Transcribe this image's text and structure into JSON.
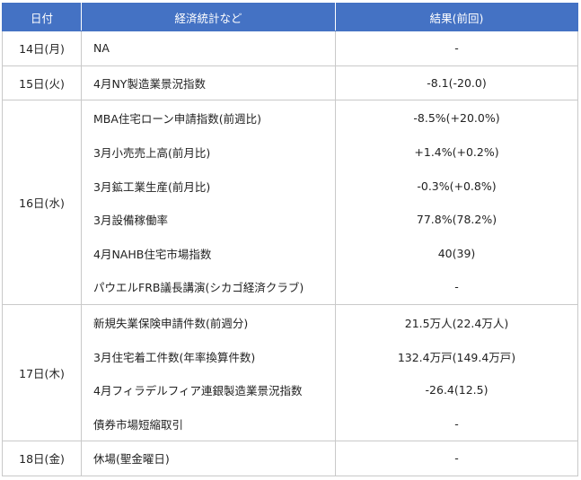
{
  "headers": {
    "date": "日付",
    "event": "経済統計など",
    "result": "結果(前回)"
  },
  "groups": [
    {
      "date": "14日(月)",
      "rows": [
        {
          "event": "NA",
          "result": "-"
        }
      ]
    },
    {
      "date": "15日(火)",
      "rows": [
        {
          "event": "4月NY製造業景況指数",
          "result": "-8.1(-20.0)"
        }
      ]
    },
    {
      "date": "16日(水)",
      "rows": [
        {
          "event": "MBA住宅ローン申請指数(前週比)",
          "result": "-8.5%(+20.0%)"
        },
        {
          "event": "3月小売売上高(前月比)",
          "result": "+1.4%(+0.2%)"
        },
        {
          "event": "3月鉱工業生産(前月比)",
          "result": "-0.3%(+0.8%)"
        },
        {
          "event": "3月設備稼働率",
          "result": "77.8%(78.2%)"
        },
        {
          "event": "4月NAHB住宅市場指数",
          "result": "40(39)"
        },
        {
          "event": "パウエルFRB議長講演(シカゴ経済クラブ)",
          "result": "-"
        }
      ]
    },
    {
      "date": "17日(木)",
      "rows": [
        {
          "event": "新規失業保険申請件数(前週分)",
          "result": "21.5万人(22.4万人)"
        },
        {
          "event": "3月住宅着工件数(年率換算件数)",
          "result": "132.4万戸(149.4万戸)"
        },
        {
          "event": "4月フィラデルフィア連銀製造業景況指数",
          "result": "-26.4(12.5)"
        },
        {
          "event": "債券市場短縮取引",
          "result": "-"
        }
      ]
    },
    {
      "date": "18日(金)",
      "rows": [
        {
          "event": "休場(聖金曜日)",
          "result": "-"
        }
      ]
    }
  ]
}
